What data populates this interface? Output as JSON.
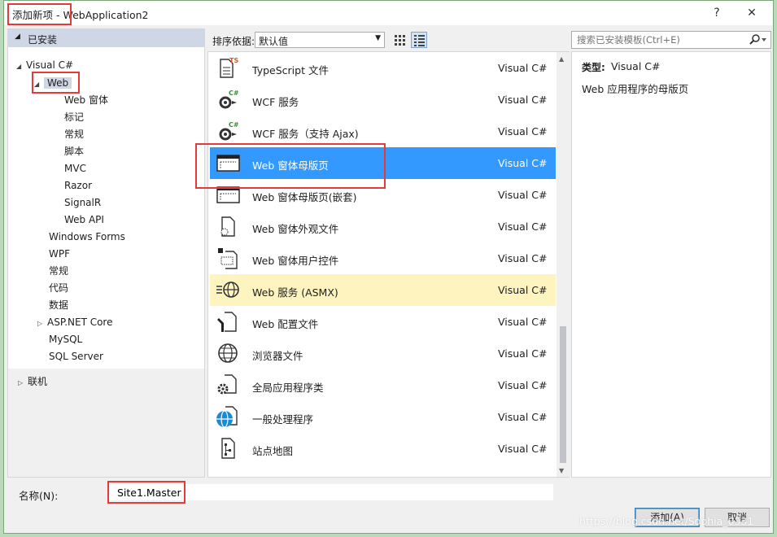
{
  "window": {
    "title": "添加新项 - WebApplication2",
    "help_label": "?",
    "close_label": "✕"
  },
  "left": {
    "installed_header": "已安装",
    "tree": {
      "visual_csharp": "Visual C#",
      "web": "Web",
      "web_children": [
        "Web 窗体",
        "标记",
        "常规",
        "脚本",
        "MVC",
        "Razor",
        "SignalR",
        "Web API"
      ],
      "siblings": [
        "Windows Forms",
        "WPF",
        "常规",
        "代码",
        "数据",
        "ASP.NET Core",
        "MySQL",
        "SQL Server"
      ],
      "online": "联机"
    }
  },
  "toolbar": {
    "sort_label": "排序依据:",
    "sort_value": "默认值"
  },
  "search": {
    "placeholder": "搜索已安装模板(Ctrl+E)"
  },
  "templates": [
    {
      "name": "TypeScript 文件",
      "lang": "Visual C#",
      "icon": "typescript-file-icon"
    },
    {
      "name": "WCF 服务",
      "lang": "Visual C#",
      "icon": "wcf-service-icon"
    },
    {
      "name": "WCF 服务（支持 Ajax)",
      "lang": "Visual C#",
      "icon": "wcf-ajax-service-icon"
    },
    {
      "name": "Web 窗体母版页",
      "lang": "Visual C#",
      "icon": "master-page-icon"
    },
    {
      "name": "Web 窗体母版页(嵌套)",
      "lang": "Visual C#",
      "icon": "nested-master-page-icon"
    },
    {
      "name": "Web 窗体外观文件",
      "lang": "Visual C#",
      "icon": "skin-file-icon"
    },
    {
      "name": "Web 窗体用户控件",
      "lang": "Visual C#",
      "icon": "user-control-icon"
    },
    {
      "name": "Web 服务 (ASMX)",
      "lang": "Visual C#",
      "icon": "web-service-icon"
    },
    {
      "name": "Web 配置文件",
      "lang": "Visual C#",
      "icon": "config-file-icon"
    },
    {
      "name": "浏览器文件",
      "lang": "Visual C#",
      "icon": "browser-file-icon"
    },
    {
      "name": "全局应用程序类",
      "lang": "Visual C#",
      "icon": "global-app-class-icon"
    },
    {
      "name": "一般处理程序",
      "lang": "Visual C#",
      "icon": "generic-handler-icon"
    },
    {
      "name": "站点地图",
      "lang": "Visual C#",
      "icon": "sitemap-icon"
    }
  ],
  "details": {
    "type_label": "类型:",
    "type_value": "Visual C#",
    "description": "Web 应用程序的母版页"
  },
  "footer": {
    "name_label": "名称(N):",
    "name_value": "Site1.Master",
    "add_label": "添加(A)",
    "cancel_label": "取消"
  },
  "watermark": "https://blog.csdn.net/Sophia_0331",
  "colors": {
    "selection": "#3399ff",
    "hover": "#fdf4bf",
    "annotation": "#e43a3a"
  }
}
